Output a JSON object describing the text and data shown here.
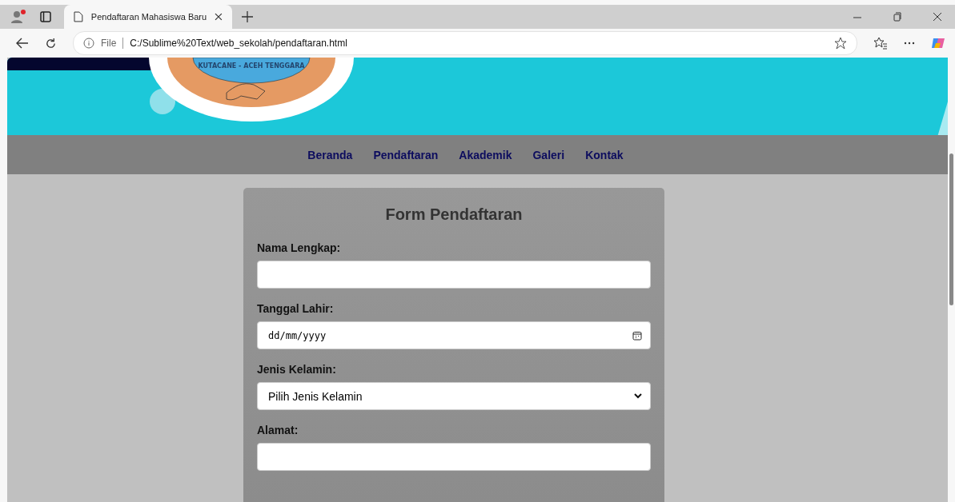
{
  "browser": {
    "tab_title": "Pendaftaran Mahasiswa Baru",
    "address_label": "File",
    "address": "C:/Sublime%20Text/web_sekolah/pendaftaran.html"
  },
  "banner": {
    "logo_text": "KUTACANE - ACEH TENGGARA"
  },
  "nav": [
    "Beranda",
    "Pendaftaran",
    "Akademik",
    "Galeri",
    "Kontak"
  ],
  "form": {
    "title": "Form Pendaftaran",
    "fields": [
      {
        "kind": "text",
        "label": "Nama Lengkap:"
      },
      {
        "kind": "date",
        "label": "Tanggal Lahir:",
        "placeholder": "dd/mm/yyyy"
      },
      {
        "kind": "select",
        "label": "Jenis Kelamin:",
        "value": "Pilih Jenis Kelamin"
      },
      {
        "kind": "text",
        "label": "Alamat:"
      }
    ]
  }
}
